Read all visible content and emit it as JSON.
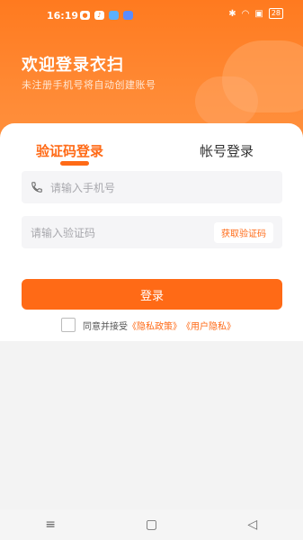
{
  "status_bar": {
    "time": "16:19",
    "battery": "28"
  },
  "header": {
    "title": "欢迎登录衣扫",
    "subtitle": "未注册手机号将自动创建账号"
  },
  "tabs": [
    {
      "label": "验证码登录",
      "active": true
    },
    {
      "label": "帐号登录",
      "active": false
    }
  ],
  "phone_field": {
    "placeholder": "请输入手机号",
    "icon": "phone-icon"
  },
  "code_field": {
    "placeholder": "请输入验证码",
    "button_label": "获取验证码"
  },
  "login_button": {
    "label": "登录"
  },
  "agreement": {
    "prefix": "同意并接受",
    "privacy_policy": "《隐私政策》",
    "user_privacy": "《用户隐私》"
  },
  "colors": {
    "accent": "#ff6a16",
    "header_bg": "#ff7a1f"
  },
  "nav": {
    "menu_icon": "≡",
    "home_icon": "▢",
    "back_icon": "◁"
  }
}
